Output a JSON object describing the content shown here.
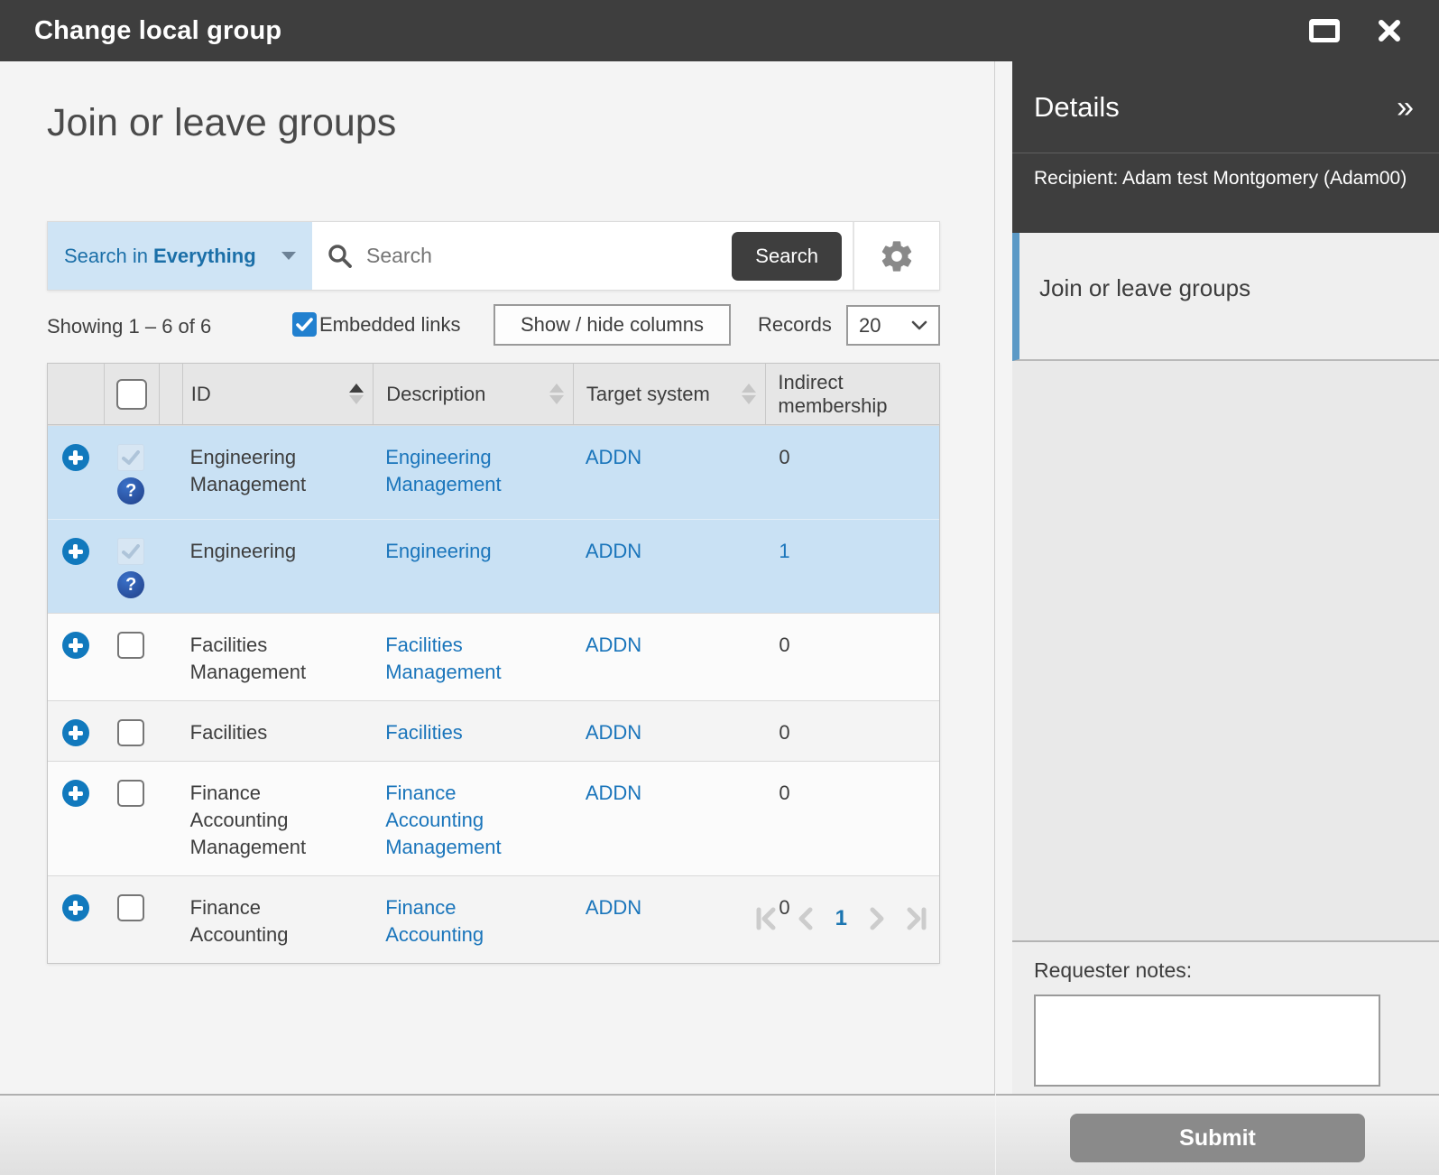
{
  "window": {
    "title": "Change local group"
  },
  "page": {
    "title": "Join or leave groups"
  },
  "search": {
    "scope_prefix": "Search in",
    "scope_value": "Everything",
    "placeholder": "Search",
    "button_label": "Search"
  },
  "toolbar": {
    "showing_text": "Showing 1 – 6 of 6",
    "embedded_links_label": "Embedded links",
    "embedded_links_checked": true,
    "show_hide_columns_label": "Show / hide columns",
    "records_label": "Records",
    "records_value": "20"
  },
  "table": {
    "columns": {
      "id": "ID",
      "description": "Description",
      "target_system": "Target system",
      "indirect": "Indirect membership"
    },
    "sort": {
      "id": "asc",
      "description": "none",
      "target_system": "none"
    },
    "rows": [
      {
        "id": "Engineering Management",
        "description": "Engineering Management",
        "target_system": "ADDN",
        "indirect": "0",
        "selected": true,
        "checked": true,
        "question_icon": true,
        "indirect_is_link": false
      },
      {
        "id": "Engineering",
        "description": "Engineering",
        "target_system": "ADDN",
        "indirect": "1",
        "selected": true,
        "checked": true,
        "question_icon": true,
        "indirect_is_link": true
      },
      {
        "id": "Facilities Management",
        "description": "Facilities Management",
        "target_system": "ADDN",
        "indirect": "0",
        "selected": false,
        "checked": false,
        "question_icon": false,
        "indirect_is_link": false
      },
      {
        "id": "Facilities",
        "description": "Facilities",
        "target_system": "ADDN",
        "indirect": "0",
        "selected": false,
        "checked": false,
        "question_icon": false,
        "indirect_is_link": false
      },
      {
        "id": "Finance Accounting Management",
        "description": "Finance Accounting Management",
        "target_system": "ADDN",
        "indirect": "0",
        "selected": false,
        "checked": false,
        "question_icon": false,
        "indirect_is_link": false
      },
      {
        "id": "Finance Accounting",
        "description": "Finance Accounting",
        "target_system": "ADDN",
        "indirect": "0",
        "selected": false,
        "checked": false,
        "question_icon": false,
        "indirect_is_link": false
      }
    ]
  },
  "pagination": {
    "current_page": "1"
  },
  "details": {
    "title": "Details",
    "recipient_text": "Recipient: Adam test Montgomery (Adam00)",
    "selected_item_label": "Join or leave groups",
    "requester_notes_label": "Requester notes:",
    "notes_value": "",
    "submit_label": "Submit"
  },
  "icons": {
    "question": "?",
    "collapse_panel": "»"
  },
  "colors": {
    "titlebar": "#3e3e3e",
    "accent_blue": "#1179bd",
    "link_blue": "#1a75bb",
    "selected_row": "#c9e1f4",
    "scope_bg": "#cfe4f5",
    "submit_gray": "#8a8a8a",
    "item_bar_blue": "#5b99c6"
  }
}
